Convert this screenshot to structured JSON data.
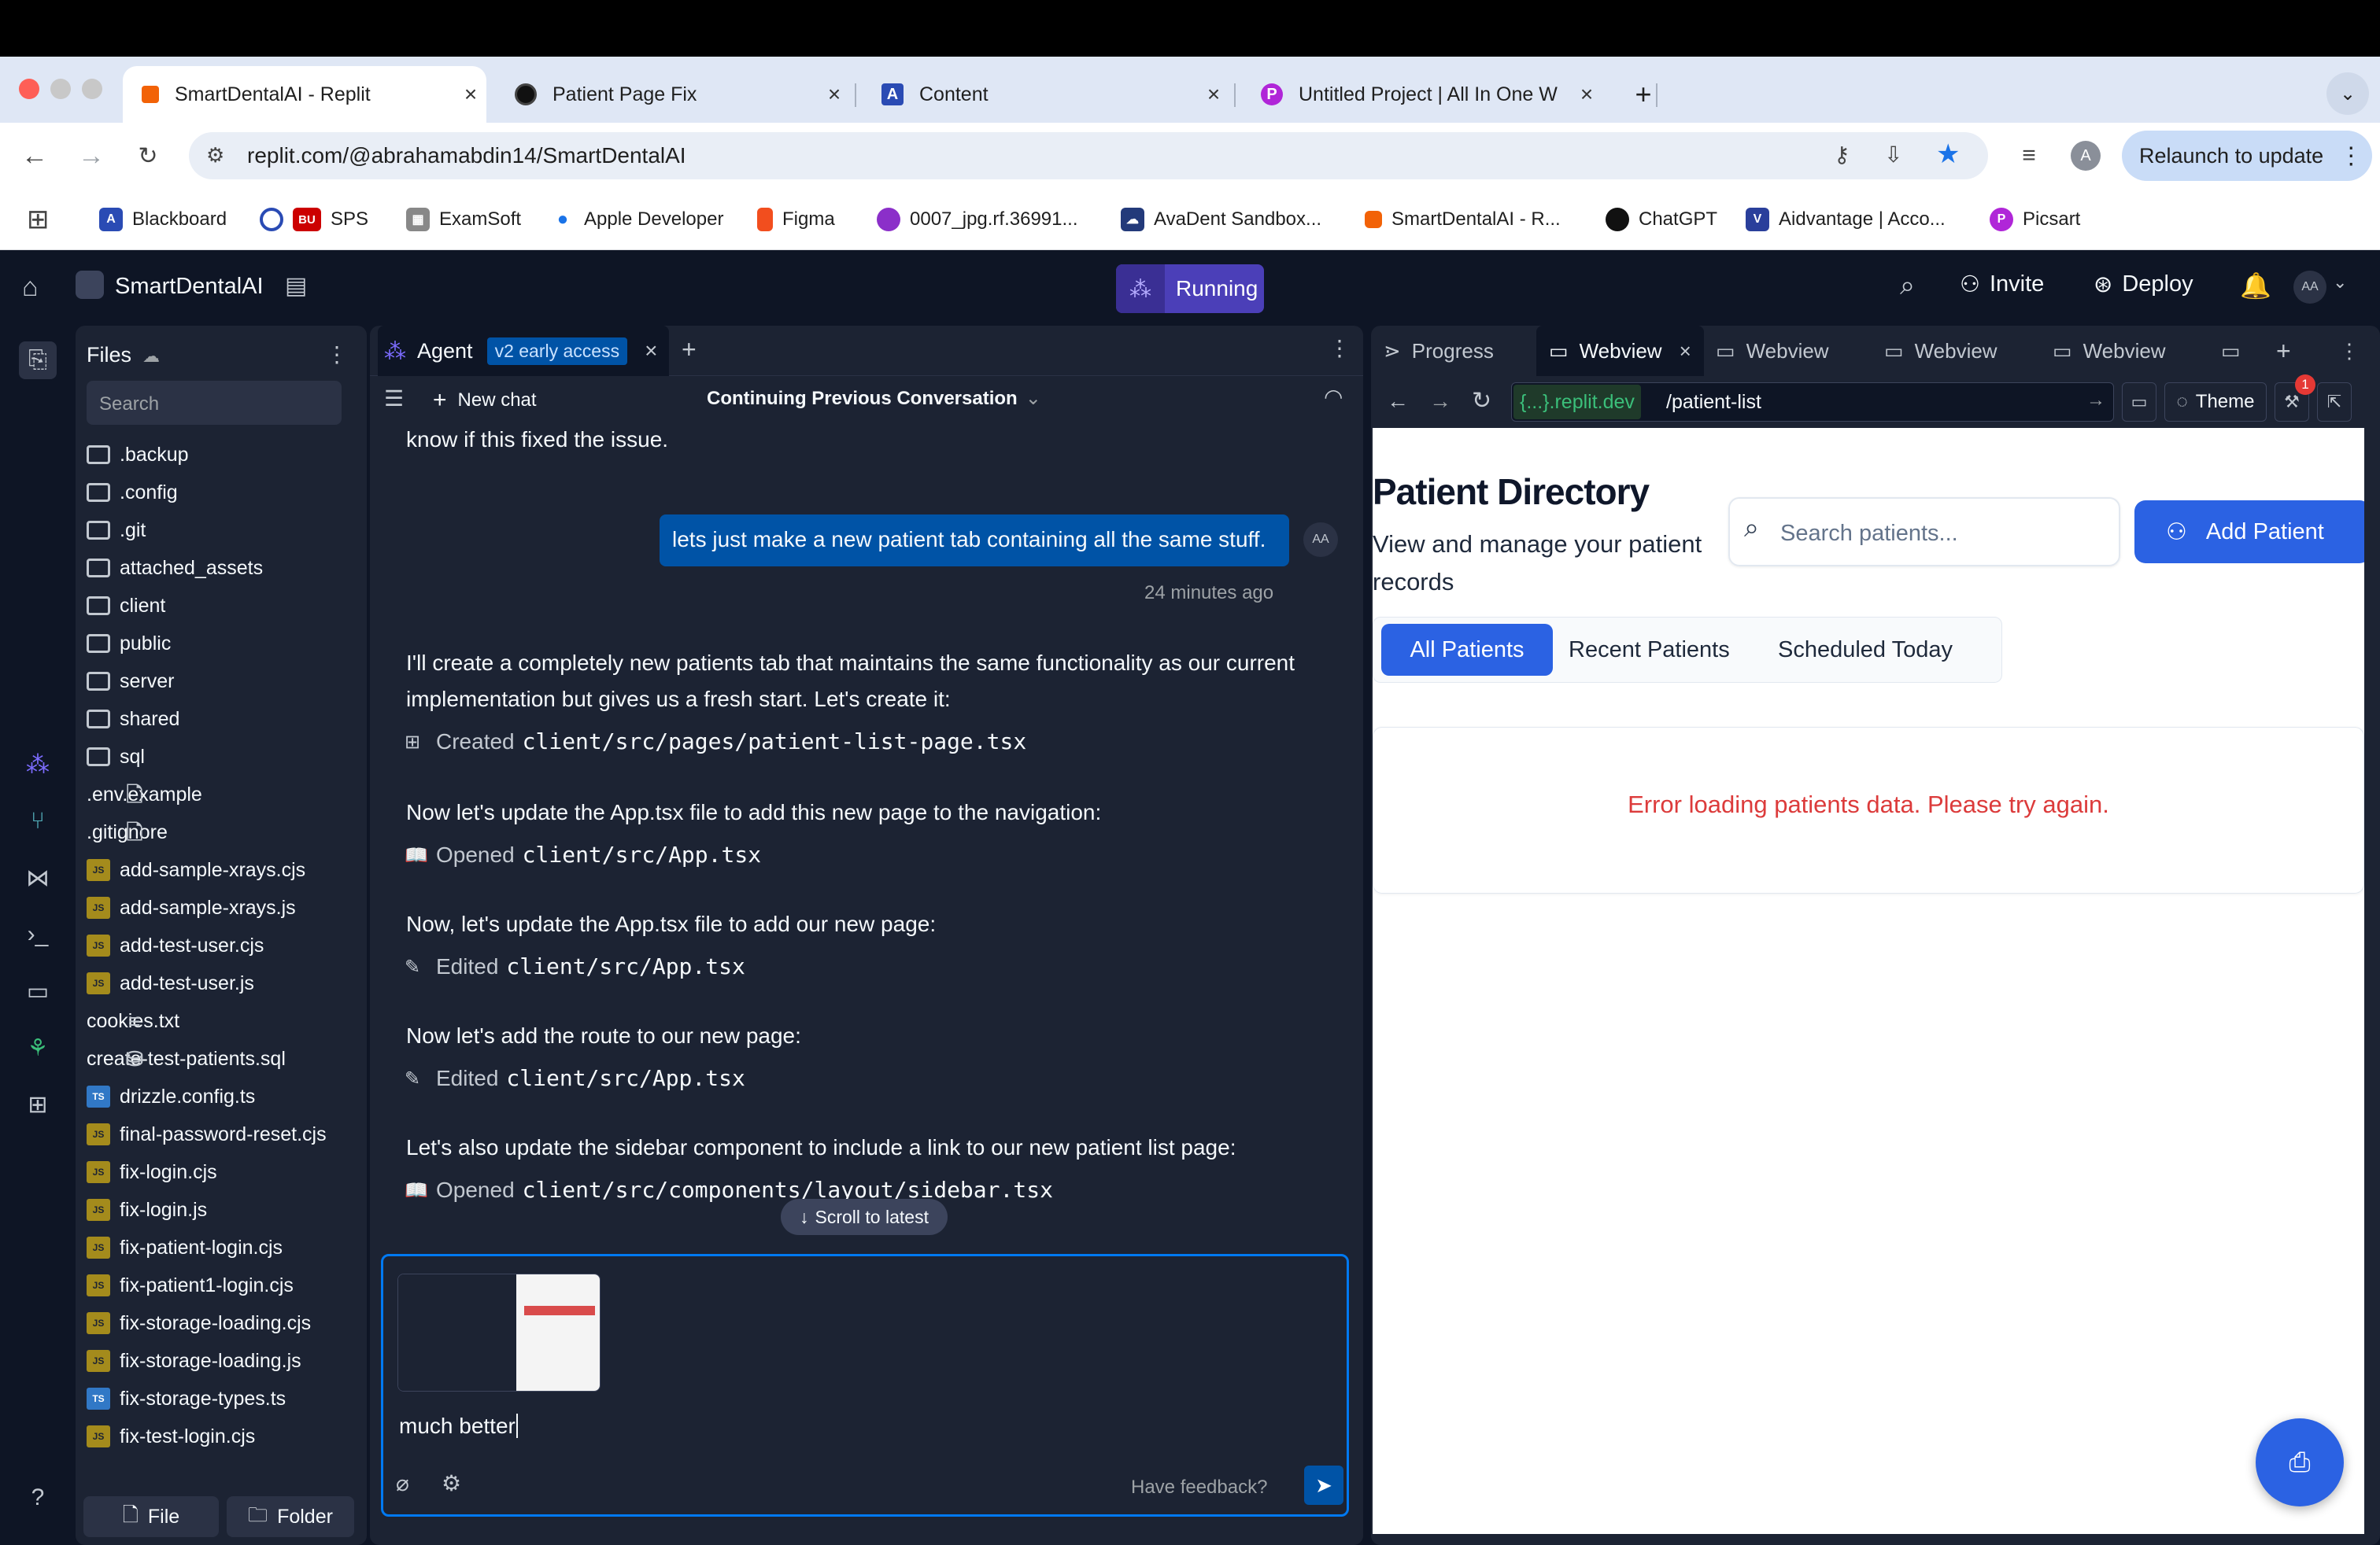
{
  "browser": {
    "tabs": [
      {
        "title": "SmartDentalAI - Replit",
        "icon": "replit-icon"
      },
      {
        "title": "Patient Page Fix",
        "icon": "openai-icon"
      },
      {
        "title": "Content",
        "icon": "aidvantage-icon"
      },
      {
        "title": "Untitled Project | All In One W",
        "icon": "picsart-icon"
      }
    ],
    "url": "replit.com/@abrahamabdin14/SmartDentalAI",
    "relaunch": "Relaunch to update",
    "profile_initial": "A",
    "bookmarks": [
      "Blackboard",
      "SPS",
      "ExamSoft",
      "Apple Developer",
      "Figma",
      "0007_jpg.rf.36991...",
      "AvaDent Sandbox...",
      "SmartDentalAI - R...",
      "ChatGPT",
      "Aidvantage | Acco...",
      "Picsart"
    ],
    "bookmark_badge_bu": "BU"
  },
  "replit": {
    "project_name": "SmartDentalAI",
    "status": "Running",
    "invite": "Invite",
    "deploy": "Deploy",
    "user_initials": "AA"
  },
  "files": {
    "title": "Files",
    "search_placeholder": "Search",
    "items": [
      {
        "name": ".backup",
        "type": "folder"
      },
      {
        "name": ".config",
        "type": "folder"
      },
      {
        "name": ".git",
        "type": "folder"
      },
      {
        "name": "attached_assets",
        "type": "folder"
      },
      {
        "name": "client",
        "type": "folder"
      },
      {
        "name": "public",
        "type": "folder"
      },
      {
        "name": "server",
        "type": "folder"
      },
      {
        "name": "shared",
        "type": "folder"
      },
      {
        "name": "sql",
        "type": "folder"
      },
      {
        "name": ".env.example",
        "type": "file"
      },
      {
        "name": ".gitignore",
        "type": "file"
      },
      {
        "name": "add-sample-xrays.cjs",
        "type": "js"
      },
      {
        "name": "add-sample-xrays.js",
        "type": "js"
      },
      {
        "name": "add-test-user.cjs",
        "type": "js"
      },
      {
        "name": "add-test-user.js",
        "type": "js"
      },
      {
        "name": "cookies.txt",
        "type": "txt"
      },
      {
        "name": "create-test-patients.sql",
        "type": "db"
      },
      {
        "name": "drizzle.config.ts",
        "type": "ts"
      },
      {
        "name": "final-password-reset.cjs",
        "type": "js"
      },
      {
        "name": "fix-login.cjs",
        "type": "js"
      },
      {
        "name": "fix-login.js",
        "type": "js"
      },
      {
        "name": "fix-patient-login.cjs",
        "type": "js"
      },
      {
        "name": "fix-patient1-login.cjs",
        "type": "js"
      },
      {
        "name": "fix-storage-loading.cjs",
        "type": "js"
      },
      {
        "name": "fix-storage-loading.js",
        "type": "js"
      },
      {
        "name": "fix-storage-types.ts",
        "type": "ts"
      },
      {
        "name": "fix-test-login.cjs",
        "type": "js"
      }
    ],
    "file_btn": "File",
    "folder_btn": "Folder"
  },
  "agent": {
    "tab_title": "Agent",
    "badge": "v2 early access",
    "new_chat": "New chat",
    "conversation": "Continuing Previous Conversation",
    "m0": "know if this fixed the issue.",
    "user_msg": "lets just make a new patient tab containing all the same stuff.",
    "user_time": "24 minutes ago",
    "user_avatar": "AA",
    "m1a": "I'll create a completely new patients tab that maintains the same functionality as our current",
    "m1b": "implementation but gives us a fresh start. Let's create it:",
    "a1_verb": "Created",
    "a1_path": "client/src/pages/patient-list-page.tsx",
    "m2": "Now let's update the App.tsx file to add this new page to the navigation:",
    "a2_verb": "Opened",
    "a2_path": "client/src/App.tsx",
    "m3": "Now, let's update the App.tsx file to add our new page:",
    "a3_verb": "Edited",
    "a3_path": "client/src/App.tsx",
    "m4": "Now let's add the route to our new page:",
    "a4_verb": "Edited",
    "a4_path": "client/src/App.tsx",
    "m5": "Let's also update the sidebar component to include a link to our new patient list page:",
    "a5_verb": "Opened",
    "a5_path": "client/src/components/layout/sidebar.tsx",
    "scroll_latest": "Scroll to latest",
    "input_value": "much better",
    "feedback": "Have feedback?"
  },
  "webview": {
    "tabs": [
      "Progress",
      "Webview",
      "Webview",
      "Webview",
      "Webview"
    ],
    "domain": "{...}.replit.dev",
    "path": "/patient-list",
    "theme": "Theme",
    "notif_count": "1",
    "page": {
      "title": "Patient Directory",
      "subtitle_l1": "View and manage your patient",
      "subtitle_l2": "records",
      "search_placeholder": "Search patients...",
      "add_btn": "Add Patient",
      "filter_tabs": [
        "All Patients",
        "Recent Patients",
        "Scheduled Today"
      ],
      "error": "Error loading patients data. Please try again."
    }
  },
  "colors": {
    "accent": "#2b62e3",
    "error": "#dc3b3b",
    "replit_running": "#4b3fb8",
    "bubble": "#0053a6"
  }
}
